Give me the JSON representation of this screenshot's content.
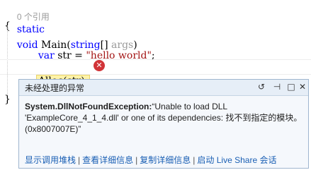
{
  "editor": {
    "ref_hint": "0 个引用",
    "line_signature": {
      "kw1": "static",
      "kw2": "void",
      "name": " Main(",
      "kw3": "string",
      "rest": "[] ",
      "arg": "args",
      "close": ")"
    },
    "open_brace": "{",
    "var_line": {
      "kw": "var",
      "mid": " str = ",
      "str": "\"hello world\"",
      "end": ";"
    },
    "alloc_line": "Alloc(str);",
    "close_brace": "}"
  },
  "popup": {
    "title": "未经处理的异常",
    "icons": {
      "history": "history-icon",
      "pin": "pin-icon",
      "close": "close-icon"
    },
    "exception_type": "System.DllNotFoundException:",
    "message": "“Unable to load DLL 'ExampleCore_4_1_4.dll' or one of its dependencies: 找不到指定的模块。 (0x8007007E)”",
    "links": [
      "显示调用堆栈",
      "查看详细信息",
      "复制详细信息",
      "启动 Live Share 会话"
    ]
  },
  "colors": {
    "keyword": "#0000ff",
    "string": "#a31515",
    "error": "#d13438",
    "link": "#1a5fb4",
    "highlight": "#fff3a8"
  }
}
